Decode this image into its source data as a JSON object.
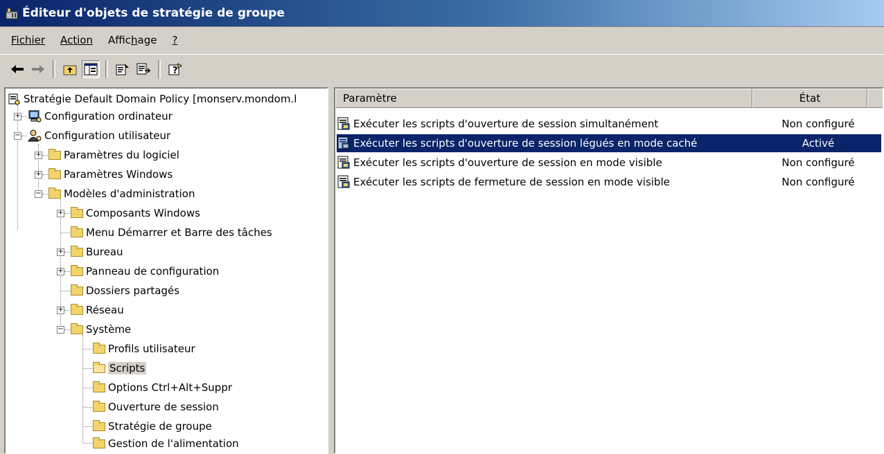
{
  "window": {
    "title": "Éditeur d'objets de stratégie de groupe"
  },
  "menu": [
    {
      "label": "Fichier",
      "mnemonic_index": 0
    },
    {
      "label": "Action",
      "mnemonic_index": 0
    },
    {
      "label": "Affichage",
      "mnemonic_index": 5
    },
    {
      "label": "?",
      "mnemonic_index": 0
    }
  ],
  "toolbar": [
    "back-arrow-icon",
    "forward-arrow-icon",
    "up-one-level-icon",
    "show-hide-tree-icon",
    "properties-icon",
    "export-list-icon",
    "help-icon"
  ],
  "tree": {
    "root": "Stratégie Default Domain Policy [monserv.mondom.l",
    "items": [
      {
        "label": "Configuration ordinateur"
      },
      {
        "label": "Configuration utilisateur"
      },
      {
        "label": "Paramètres du logiciel"
      },
      {
        "label": "Paramètres Windows"
      },
      {
        "label": "Modèles d'administration"
      },
      {
        "label": "Composants Windows"
      },
      {
        "label": "Menu Démarrer et Barre des tâches"
      },
      {
        "label": "Bureau"
      },
      {
        "label": "Panneau de configuration"
      },
      {
        "label": "Dossiers partagés"
      },
      {
        "label": "Réseau"
      },
      {
        "label": "Système"
      },
      {
        "label": "Profils utilisateur"
      },
      {
        "label": "Scripts"
      },
      {
        "label": "Options Ctrl+Alt+Suppr"
      },
      {
        "label": "Ouverture de session"
      },
      {
        "label": "Stratégie de groupe"
      },
      {
        "label": "Gestion de l'alimentation"
      }
    ]
  },
  "list": {
    "columns": [
      "Paramètre",
      "État"
    ],
    "rows": [
      {
        "name": "Exécuter les scripts d'ouverture de session simultanément",
        "state": "Non configuré"
      },
      {
        "name": "Exécuter les scripts d'ouverture de session légués en mode caché",
        "state": "Activé"
      },
      {
        "name": "Exécuter les scripts d'ouverture de session en mode visible",
        "state": "Non configuré"
      },
      {
        "name": "Exécuter les scripts de fermeture de session en mode visible",
        "state": "Non configuré"
      }
    ]
  },
  "colors": {
    "selection": "#0a246a",
    "chrome": "#d4d0c8"
  }
}
